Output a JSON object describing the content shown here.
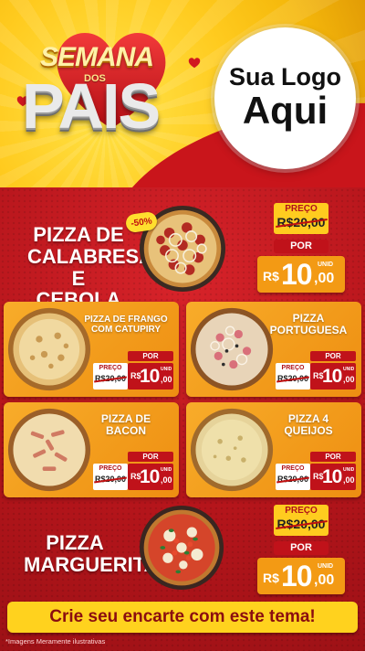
{
  "header": {
    "title_top": "SEMANA",
    "title_mid": "DOS",
    "title_main": "PAIS",
    "logo_line1": "Sua Logo",
    "logo_line2": "Aqui"
  },
  "featured": [
    {
      "name_lines": [
        "PIZZA DE",
        "CALABRESA",
        "E CEBOLA"
      ],
      "discount": "-50%",
      "preco_label": "PREÇO",
      "old_price": "R$20,00",
      "por_label": "POR",
      "currency": "R$",
      "price": "10",
      "cents": ",00",
      "unit": "UNID"
    },
    {
      "name_lines": [
        "PIZZA",
        "MARGUERITA"
      ],
      "preco_label": "PREÇO",
      "old_price": "R$20,00",
      "por_label": "POR",
      "currency": "R$",
      "price": "10",
      "cents": ",00",
      "unit": "UNID"
    }
  ],
  "cards": [
    {
      "name_lines": [
        "PIZZA DE FRANGO",
        "COM CATUPIRY"
      ],
      "preco_label": "PREÇO",
      "old_price": "R$20,00",
      "por_label": "POR",
      "currency": "R$",
      "price": "10",
      "cents": ",00",
      "unit": "UNID"
    },
    {
      "name_lines": [
        "PIZZA",
        "PORTUGUESA"
      ],
      "preco_label": "PREÇO",
      "old_price": "R$20,00",
      "por_label": "POR",
      "currency": "R$",
      "price": "10",
      "cents": ",00",
      "unit": "UNID"
    },
    {
      "name_lines": [
        "PIZZA DE",
        "BACON"
      ],
      "preco_label": "PREÇO",
      "old_price": "R$20,00",
      "por_label": "POR",
      "currency": "R$",
      "price": "10",
      "cents": ",00",
      "unit": "UNID"
    },
    {
      "name_lines": [
        "PIZZA 4",
        "QUEIJOS"
      ],
      "preco_label": "PREÇO",
      "old_price": "R$20,00",
      "por_label": "POR",
      "currency": "R$",
      "price": "10",
      "cents": ",00",
      "unit": "UNID"
    }
  ],
  "banner": "Crie seu encarte com este tema!",
  "footnote": "*Imagens Meramente ilustrativas",
  "colors": {
    "red": "#c0121a",
    "yellow": "#ffcc1f",
    "orange": "#f39a14"
  }
}
